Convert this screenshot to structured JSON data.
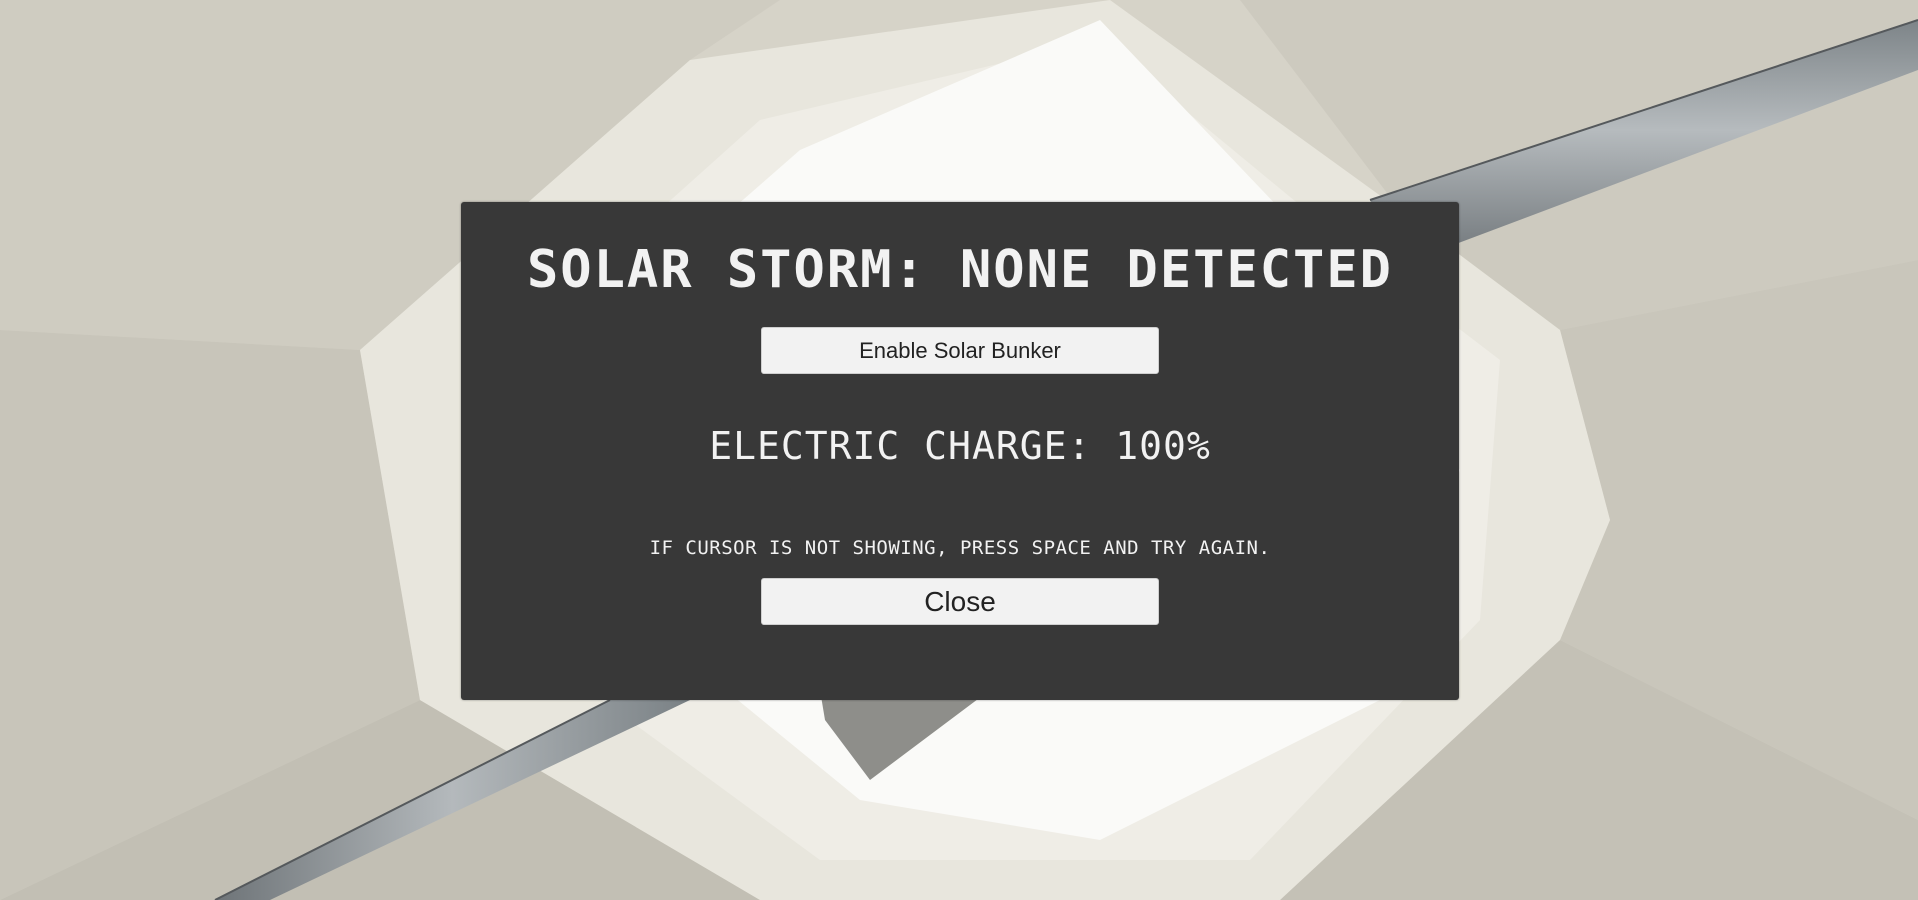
{
  "dialog": {
    "storm_status": "SOLAR STORM: NONE DETECTED",
    "enable_button_label": "Enable Solar Bunker",
    "electric_charge": "ELECTRIC CHARGE: 100%",
    "cursor_hint": "IF CURSOR IS NOT SHOWING, PRESS SPACE AND TRY AGAIN.",
    "close_button_label": "Close"
  },
  "colors": {
    "panel_background": "#383838",
    "panel_text": "#f2f2f2",
    "button_background": "#f2f2f2",
    "button_text": "#222222",
    "scene_concrete": "#d9d6cc",
    "scene_pipe": "#9ea3a6"
  }
}
